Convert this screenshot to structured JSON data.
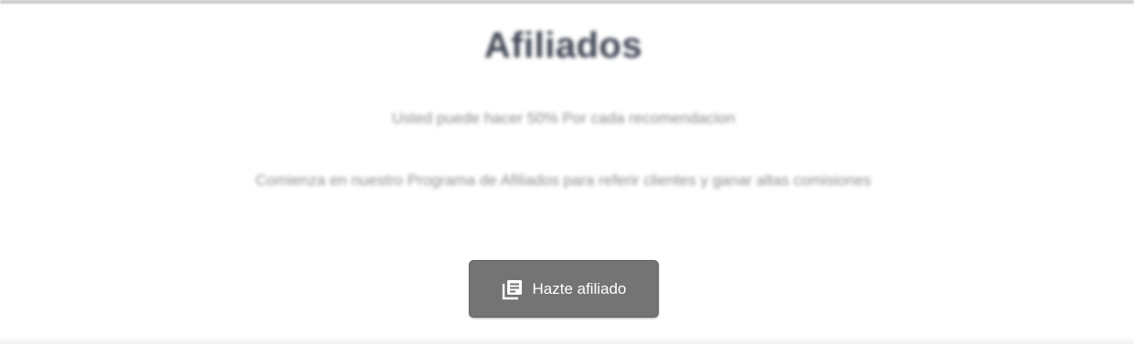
{
  "section": {
    "title": "Afiliados",
    "subtitle": "Usted puede hacer 50% Por cada recomendacion",
    "description": "Comienza en nuestro Programa de Afiliados para referir clientes y ganar altas comisiones"
  },
  "cta": {
    "label": "Hazte afiliado",
    "icon": "library-books-icon"
  },
  "colors": {
    "button_background": "#747474",
    "title_text": "#3f4654",
    "body_text": "#8c8c8c"
  }
}
